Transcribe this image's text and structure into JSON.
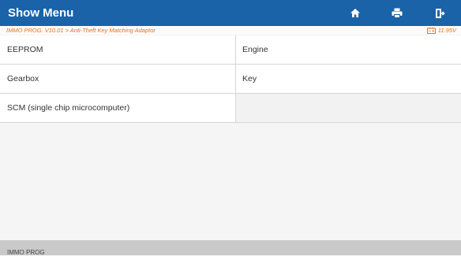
{
  "header": {
    "title": "Show Menu",
    "bg_color": "#1a63a8",
    "buttons": [
      {
        "icon": "home-icon"
      },
      {
        "icon": "print-icon"
      },
      {
        "icon": "exit-icon"
      }
    ]
  },
  "subheader": {
    "breadcrumb": "IMMO PROG. V10.01 > Anti-Theft Key Matching Adaptor",
    "voltage": "11.95V",
    "voltage_icon": "battery-icon",
    "accent_color": "#e8731c"
  },
  "menu": {
    "items": [
      {
        "label": "EEPROM"
      },
      {
        "label": "Engine"
      },
      {
        "label": "Gearbox"
      },
      {
        "label": "Key"
      },
      {
        "label": "SCM (single chip microcomputer)"
      }
    ]
  },
  "footer": {
    "label": "IMMO PROG"
  }
}
